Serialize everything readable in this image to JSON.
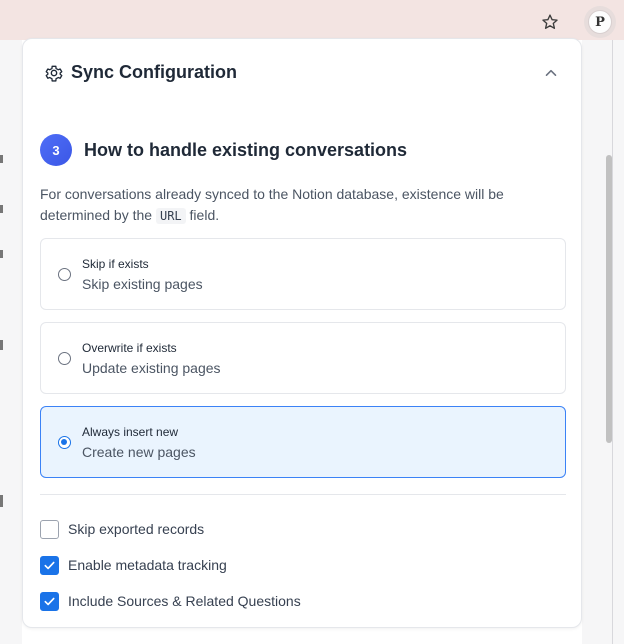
{
  "browser": {
    "bookmark_icon": "star-icon",
    "extension_letter": "P"
  },
  "panel": {
    "title": "Sync Configuration",
    "icon": "gear-icon",
    "collapse_icon": "chevron-up-icon"
  },
  "step": {
    "number": "3",
    "title": "How to handle existing conversations",
    "description_before": "For conversations already synced to the Notion database, existence will be determined by the",
    "description_code": "URL",
    "description_after": "field."
  },
  "options": [
    {
      "label": "Skip if exists",
      "sub": "Skip existing pages",
      "selected": false
    },
    {
      "label": "Overwrite if exists",
      "sub": "Update existing pages",
      "selected": false
    },
    {
      "label": "Always insert new",
      "sub": "Create new pages",
      "selected": true
    }
  ],
  "checkboxes": [
    {
      "label": "Skip exported records",
      "checked": false
    },
    {
      "label": "Enable metadata tracking",
      "checked": true
    },
    {
      "label": "Include Sources & Related Questions",
      "checked": true
    }
  ],
  "colors": {
    "accent": "#1a73e8",
    "badge": "#4f6ef7",
    "selected_bg": "#eaf4fe",
    "browser_bar": "#f3e4e2"
  }
}
